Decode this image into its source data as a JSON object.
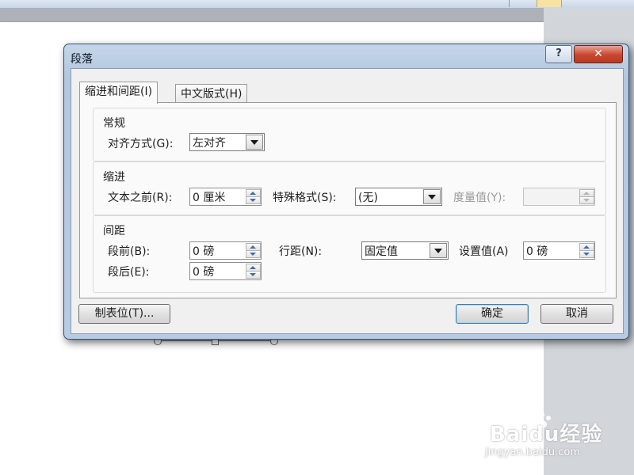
{
  "dialog": {
    "title": "段落",
    "help_label": "?",
    "close_label": "✕",
    "tabs": [
      {
        "label": "缩进和间距(I)",
        "active": true
      },
      {
        "label": "中文版式(H)",
        "active": false
      }
    ],
    "general": {
      "title": "常规",
      "alignment_label": "对齐方式(G):",
      "alignment_value": "左对齐"
    },
    "indent": {
      "title": "缩进",
      "before_text_label": "文本之前(R):",
      "before_text_value": "0 厘米",
      "special_format_label": "特殊格式(S):",
      "special_format_value": "(无)",
      "measure_label": "度量值(Y):",
      "measure_value": ""
    },
    "spacing": {
      "title": "间距",
      "before_label": "段前(B):",
      "before_value": "0 磅",
      "after_label": "段后(E):",
      "after_value": "0 磅",
      "line_spacing_label": "行距(N):",
      "line_spacing_value": "固定值",
      "set_value_label": "设置值(A)",
      "set_value_value": "0 磅"
    },
    "tabs_button_label": "制表位(T)...",
    "ok_label": "确定",
    "cancel_label": "取消"
  },
  "watermark": {
    "brand": "Baidu经验",
    "url": "jingyan.baidu.com"
  },
  "colors": {
    "title_bar": "#b8cbe2",
    "close_button": "#c8462e",
    "client_bg": "#f0f0f0",
    "spin_arrow": "#3f6fa8"
  }
}
